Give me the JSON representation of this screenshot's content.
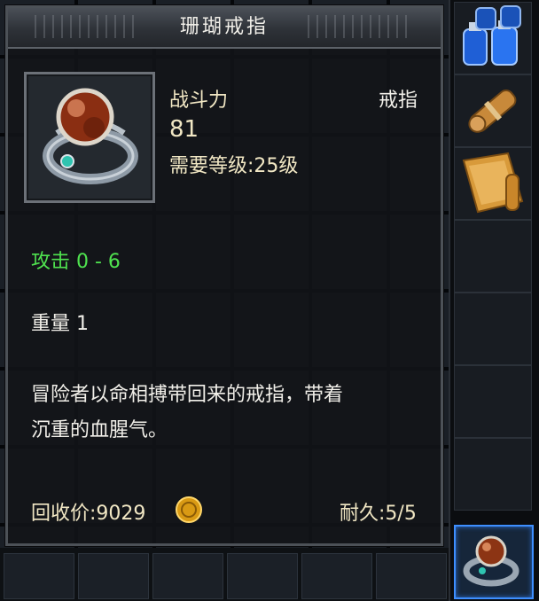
{
  "tooltip": {
    "title": "珊瑚戒指",
    "power_label": "战斗力",
    "power_value": "81",
    "slot_type": "戒指",
    "level_req": "需要等级:25级",
    "attack": "攻击 0 - 6",
    "weight": "重量 1",
    "desc_line1": "冒险者以命相搏带回来的戒指，带着",
    "desc_line2": "沉重的血腥气。",
    "recycle_price": "回收价:9029",
    "durability": "耐久:5/5"
  },
  "item_icon": "coral-ring-icon",
  "colors": {
    "title": "#f1efe9",
    "stat_gold": "#f1e7c4",
    "attack_green": "#4fe24f",
    "selected_border": "#3e8fff"
  },
  "side_slots": [
    {
      "icon": "potion-bottles-icon"
    },
    {
      "icon": "scroll-icon"
    },
    {
      "icon": "map-scroll-icon"
    },
    {
      "icon": "empty"
    },
    {
      "icon": "empty"
    },
    {
      "icon": "empty"
    },
    {
      "icon": "empty"
    },
    {
      "icon": "coral-ring-icon",
      "selected": true
    }
  ]
}
